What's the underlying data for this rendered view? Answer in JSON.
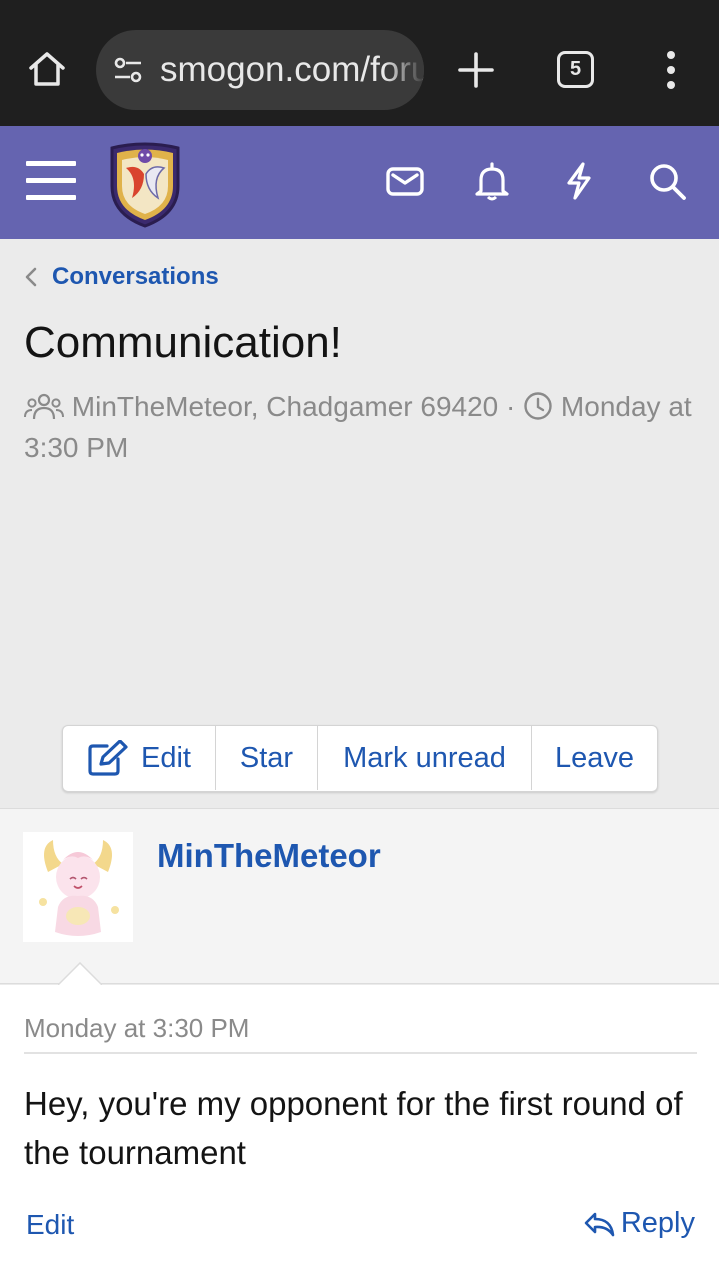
{
  "browser": {
    "url": "smogon.com/forums/conversations",
    "tab_count": "5"
  },
  "breadcrumb": {
    "label": "Conversations"
  },
  "conversation": {
    "title": "Communication!",
    "participants": "MinTheMeteor, Chadgamer 69420",
    "separator": "·",
    "date": "Monday at 3:30 PM"
  },
  "actions": {
    "edit": "Edit",
    "star": "Star",
    "mark_unread": "Mark unread",
    "leave": "Leave"
  },
  "message": {
    "author": "MinTheMeteor",
    "date": "Monday at 3:30 PM",
    "text": "Hey, you're my opponent for the first round of the tournament",
    "edit": "Edit",
    "reply": "Reply"
  },
  "colors": {
    "header": "#6564b0",
    "link": "#1e57b0",
    "chrome": "#1f1f1f"
  },
  "icons": [
    "home-icon",
    "tune-icon",
    "plus-icon",
    "tabs-icon",
    "more-vert-icon",
    "menu-icon",
    "site-logo",
    "mail-icon",
    "bell-icon",
    "bolt-icon",
    "search-icon",
    "chevron-left-icon",
    "users-icon",
    "clock-icon",
    "edit-icon",
    "reply-icon"
  ]
}
